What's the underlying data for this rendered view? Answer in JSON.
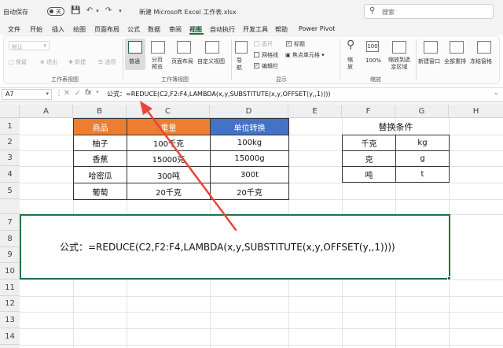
{
  "titlebar": {
    "autosave_label": "自动保存",
    "autosave_state": "关",
    "filename": "新建 Microsoft Excel 工作表.xlsx",
    "search_placeholder": "搜索"
  },
  "menu": [
    "文件",
    "开始",
    "插入",
    "绘图",
    "页面布局",
    "公式",
    "数据",
    "审阅",
    "视图",
    "自动执行",
    "开发工具",
    "帮助",
    "Power Pivot"
  ],
  "ribbon": {
    "sheetview": {
      "default": "默认",
      "keep": "保留",
      "exit": "退出",
      "new": "新建",
      "options": "选项",
      "group": "工作表视图"
    },
    "workbookview": {
      "normal": "普通",
      "pagebreak": "分页预览",
      "pagelayout": "页面布局",
      "custom": "自定义视图",
      "group": "工作簿视图"
    },
    "show": {
      "navigate": "导航",
      "ruler": "直尺",
      "gridlines": "网格线",
      "formulabar": "编辑栏",
      "headings": "标题",
      "focus": "焦点单元格",
      "group": "显示"
    },
    "zoom": {
      "zoom": "缩放",
      "hundred": "100%",
      "toselection": "缩放到选定区域",
      "group": "缩放"
    },
    "window": {
      "newwindow": "新建窗口",
      "arrange": "全部重排",
      "freeze": "冻结窗格"
    }
  },
  "formulabar": {
    "namebox": "A7",
    "fx": "fx",
    "content": "公式：=REDUCE(C2,F2:F4,LAMBDA(x,y,SUBSTITUTE(x,y,OFFSET(y,,1))))"
  },
  "columns": [
    "A",
    "B",
    "C",
    "D",
    "E",
    "F",
    "G",
    "H"
  ],
  "rows": [
    "1",
    "2",
    "3",
    "4",
    "5",
    "7",
    "8",
    "9",
    "10",
    "11",
    "12",
    "13",
    "14"
  ],
  "table1": {
    "headers": [
      "商品",
      "重量",
      "单位转换"
    ],
    "rows": [
      [
        "柚子",
        "100千克",
        "100kg"
      ],
      [
        "香蕉",
        "15000克",
        "15000g"
      ],
      [
        "哈密瓜",
        "300吨",
        "300t"
      ],
      [
        "葡萄",
        "20千克",
        "20千克"
      ]
    ]
  },
  "table2": {
    "title": "替换条件",
    "rows": [
      [
        "千克",
        "kg"
      ],
      [
        "克",
        "g"
      ],
      [
        "吨",
        "t"
      ]
    ]
  },
  "merged_cell_text": "公式：=REDUCE(C2,F2:F4,LAMBDA(x,y,SUBSTITUTE(x,y,OFFSET(y,,1))))",
  "colors": {
    "orange_header": "#ed7d31",
    "blue_header": "#4472c4",
    "excel_green": "#1f7244",
    "arrow": "#e8453c"
  }
}
